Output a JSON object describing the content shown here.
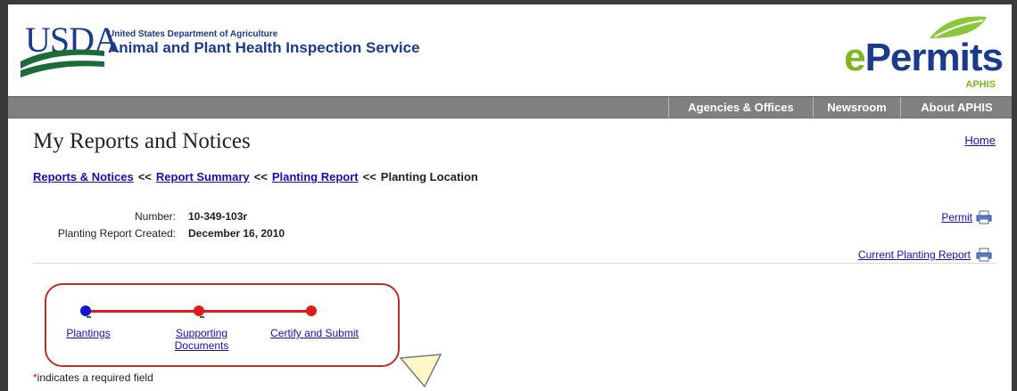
{
  "header": {
    "usda_word": "USDA",
    "agency_small": "United States Department of Agriculture",
    "agency_name": "Animal and Plant Health Inspection Service",
    "epermits_e": "e",
    "epermits_rest": "Permits",
    "aphis_sub": "APHIS"
  },
  "nav": {
    "items": [
      "Agencies & Offices",
      "Newsroom",
      "About APHIS"
    ]
  },
  "page": {
    "title": "My Reports and Notices",
    "home_link": "Home"
  },
  "breadcrumb": {
    "items": [
      "Reports & Notices",
      "Report Summary",
      "Planting Report"
    ],
    "separator": "<<",
    "current": "Planting Location"
  },
  "info": {
    "number_label": "Number:",
    "number_value": "10-349-103r",
    "created_label": "Planting Report Created:",
    "created_value": "December 16, 2010"
  },
  "links": {
    "permit": "Permit",
    "current_planting_report": "Current Planting Report"
  },
  "progress": {
    "steps": [
      {
        "label": "Plantings",
        "state": "current"
      },
      {
        "label": "Supporting Documents",
        "label_line1": "Supporting",
        "label_line2": "Documents",
        "state": "pending"
      },
      {
        "label": "Certify and Submit",
        "state": "pending"
      }
    ],
    "current_color": "#1414d8",
    "pending_color": "#e01b1b"
  },
  "footer": {
    "required_star": "*",
    "required_text": "indicates a required field"
  },
  "colors": {
    "brand_blue": "#1b3a8c",
    "brand_green": "#7fb51e",
    "navbar_gray": "#808080",
    "link_blue": "#1a0dab",
    "highlight_red": "#b8302a"
  }
}
